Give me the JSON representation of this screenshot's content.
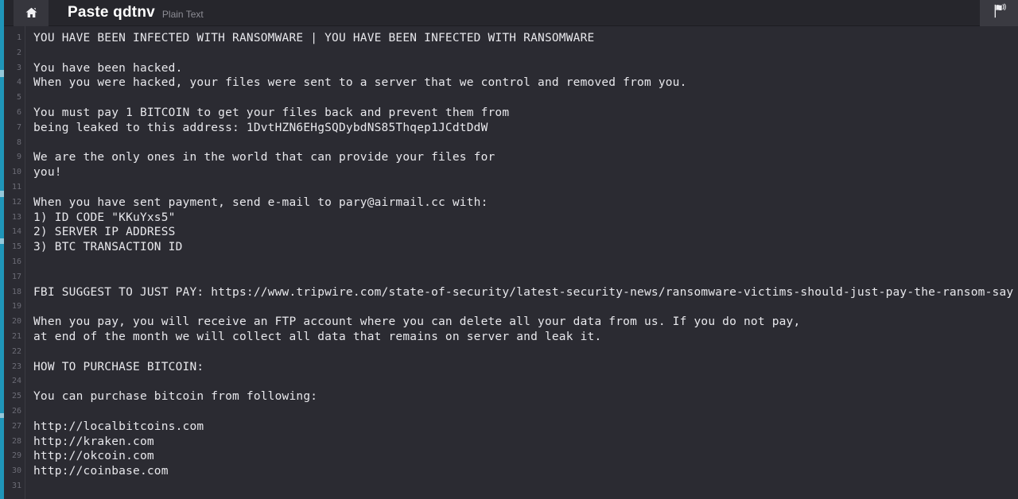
{
  "topbar": {
    "home_icon": "home-icon",
    "title": "Paste qdtnv",
    "format": "Plain Text",
    "flag_icon": "flag-icon",
    "home_button_label": "",
    "flag_button_label": ""
  },
  "editor": {
    "line_numbers": [
      "1",
      "2",
      "3",
      "4",
      "5",
      "6",
      "7",
      "8",
      "9",
      "10",
      "11",
      "12",
      "13",
      "14",
      "15",
      "16",
      "17",
      "18",
      "19",
      "20",
      "21",
      "22",
      "23",
      "24",
      "25",
      "26",
      "27",
      "28",
      "29",
      "30",
      "31"
    ],
    "lines": [
      "YOU HAVE BEEN INFECTED WITH RANSOMWARE | YOU HAVE BEEN INFECTED WITH RANSOMWARE",
      "",
      "You have been hacked.",
      "When you were hacked, your files were sent to a server that we control and removed from you.",
      "",
      "You must pay 1 BITCOIN to get your files back and prevent them from",
      "being leaked to this address: 1DvtHZN6EHgSQDybdNS85Thqep1JCdtDdW",
      "",
      "We are the only ones in the world that can provide your files for",
      "you!",
      "",
      "When you have sent payment, send e-mail to pary@airmail.cc with:",
      "1) ID CODE \"KKuYxs5\"",
      "2) SERVER IP ADDRESS",
      "3) BTC TRANSACTION ID",
      "",
      "",
      "FBI SUGGEST TO JUST PAY: https://www.tripwire.com/state-of-security/latest-security-news/ransomware-victims-should-just-pay-the-ransom-say",
      "",
      "When you pay, you will receive an FTP account where you can delete all your data from us. If you do not pay,",
      "at end of the month we will collect all data that remains on server and leak it.",
      "",
      "HOW TO PURCHASE BITCOIN:",
      "",
      "You can purchase bitcoin from following:",
      "",
      "http://localbitcoins.com",
      "http://kraken.com",
      "http://okcoin.com",
      "http://coinbase.com",
      ""
    ]
  },
  "colors": {
    "accent_rail": "#1f95b8",
    "topbar_bg": "#26262c",
    "editor_bg": "#2b2b32",
    "text": "#e8e8ec",
    "gutter_text": "#6c6c76",
    "format_text": "#8d8d95"
  }
}
